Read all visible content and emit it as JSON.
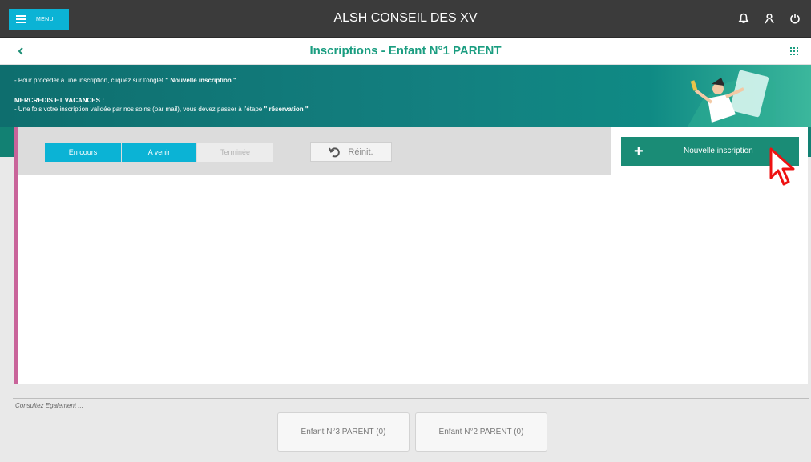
{
  "app": {
    "title": "ALSH CONSEIL DES XV",
    "menu_label": "MENU"
  },
  "header": {
    "back_icon": "chevron-left-icon",
    "page_title": "Inscriptions  -  Enfant N°1 PARENT",
    "right_icons": [
      "bell-icon",
      "user-icon",
      "power-icon"
    ],
    "apps_icon": "grid-icon"
  },
  "banner": {
    "line1_prefix": "- Pour procéder à une inscription, cliquez sur l'onglet ",
    "line1_bold": "\" Nouvelle inscription \"",
    "heading": "MERCREDIS ET VACANCES :",
    "line2_prefix": "- Une fois votre inscription validée par nos soins (par mail), vous devez passer à l'étape ",
    "line2_bold": "\" réservation \""
  },
  "filters": {
    "tabs": [
      {
        "label": "En cours",
        "active": true
      },
      {
        "label": "A venir",
        "active": true
      },
      {
        "label": "Terminée",
        "active": false
      }
    ],
    "reset_label": "Réinit."
  },
  "actions": {
    "new_inscription_label": "Nouvelle inscription"
  },
  "footer": {
    "consult_label": "Consultez Egalement ...",
    "children": [
      {
        "label": "Enfant N°3 PARENT (0)"
      },
      {
        "label": "Enfant N°2 PARENT (0)"
      }
    ]
  },
  "colors": {
    "topbar": "#3b3b3b",
    "accent_cyan": "#0bb3d5",
    "teal": "#1a9d80",
    "banner": "#138080",
    "pink_border": "#c9649a"
  }
}
